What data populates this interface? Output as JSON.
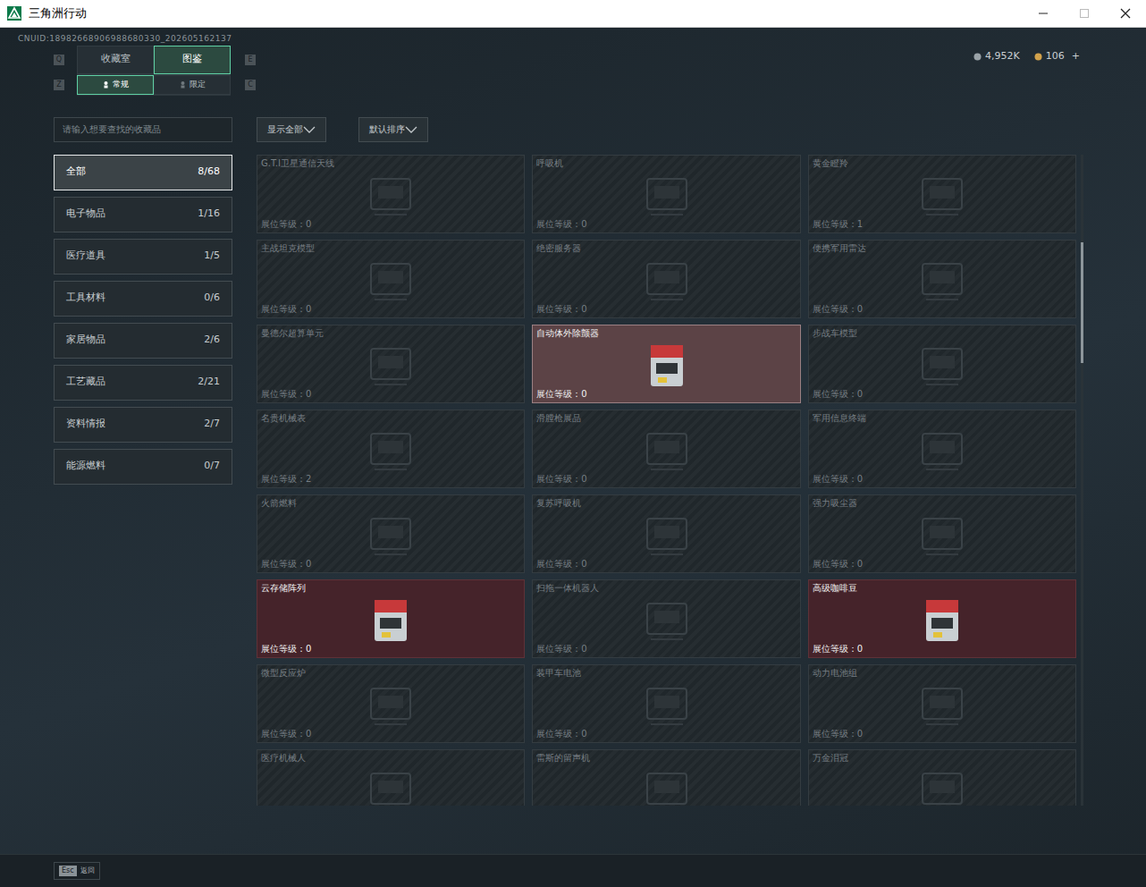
{
  "window": {
    "title": "三角洲行动"
  },
  "account": {
    "uid": "CNUID:18982668906988680330_202605162137"
  },
  "currency": [
    {
      "value": "4,952K",
      "add": ""
    },
    {
      "value": "106",
      "add": "+"
    }
  ],
  "main_tabs": {
    "prev_key": "Q",
    "next_key": "E",
    "items": [
      {
        "label": "收藏室",
        "selected": false
      },
      {
        "label": "图鉴",
        "selected": true
      }
    ]
  },
  "sub_tabs": {
    "prev_key": "Z",
    "next_key": "C",
    "items": [
      {
        "label": "常规",
        "selected": true
      },
      {
        "label": "限定",
        "selected": false
      }
    ]
  },
  "search": {
    "placeholder": "请输入想要查找的收藏品"
  },
  "filters": [
    {
      "label": "显示全部"
    },
    {
      "label": "默认排序"
    }
  ],
  "categories": [
    {
      "label": "全部",
      "count": "8/68",
      "selected": true
    },
    {
      "label": "电子物品",
      "count": "1/16",
      "selected": false
    },
    {
      "label": "医疗道具",
      "count": "1/5",
      "selected": false
    },
    {
      "label": "工具材料",
      "count": "0/6",
      "selected": false
    },
    {
      "label": "家居物品",
      "count": "2/6",
      "selected": false
    },
    {
      "label": "工艺藏品",
      "count": "2/21",
      "selected": false
    },
    {
      "label": "资料情报",
      "count": "2/7",
      "selected": false
    },
    {
      "label": "能源燃料",
      "count": "0/7",
      "selected": false
    }
  ],
  "items": [
    {
      "name": "G.T.I卫星通信天线",
      "level_text": "展位等级：0",
      "collected": false,
      "highlighted": false
    },
    {
      "name": "呼吸机",
      "level_text": "展位等级：0",
      "collected": false,
      "highlighted": false
    },
    {
      "name": "黄金瞪羚",
      "level_text": "展位等级：1",
      "collected": false,
      "highlighted": false
    },
    {
      "name": "主战坦克模型",
      "level_text": "展位等级：0",
      "collected": false,
      "highlighted": false
    },
    {
      "name": "绝密服务器",
      "level_text": "展位等级：0",
      "collected": false,
      "highlighted": false
    },
    {
      "name": "便携军用雷达",
      "level_text": "展位等级：0",
      "collected": false,
      "highlighted": false
    },
    {
      "name": "曼德尔超算单元",
      "level_text": "展位等级：0",
      "collected": false,
      "highlighted": false
    },
    {
      "name": "自动体外除颤器",
      "level_text": "展位等级：0",
      "collected": true,
      "highlighted": true
    },
    {
      "name": "步战车模型",
      "level_text": "展位等级：0",
      "collected": false,
      "highlighted": false
    },
    {
      "name": "名贵机械表",
      "level_text": "展位等级：2",
      "collected": false,
      "highlighted": false
    },
    {
      "name": "滑膛枪展品",
      "level_text": "展位等级：0",
      "collected": false,
      "highlighted": false
    },
    {
      "name": "军用信息终端",
      "level_text": "展位等级：0",
      "collected": false,
      "highlighted": false
    },
    {
      "name": "火箭燃料",
      "level_text": "展位等级：0",
      "collected": false,
      "highlighted": false
    },
    {
      "name": "复苏呼吸机",
      "level_text": "展位等级：0",
      "collected": false,
      "highlighted": false
    },
    {
      "name": "强力吸尘器",
      "level_text": "展位等级：0",
      "collected": false,
      "highlighted": false
    },
    {
      "name": "云存储阵列",
      "level_text": "展位等级：0",
      "collected": true,
      "highlighted": false
    },
    {
      "name": "扫拖一体机器人",
      "level_text": "展位等级：0",
      "collected": false,
      "highlighted": false
    },
    {
      "name": "高级咖啡豆",
      "level_text": "展位等级：0",
      "collected": true,
      "highlighted": false
    },
    {
      "name": "微型反应炉",
      "level_text": "展位等级：0",
      "collected": false,
      "highlighted": false
    },
    {
      "name": "装甲车电池",
      "level_text": "展位等级：0",
      "collected": false,
      "highlighted": false
    },
    {
      "name": "动力电池组",
      "level_text": "展位等级：0",
      "collected": false,
      "highlighted": false
    },
    {
      "name": "医疗机械人",
      "level_text": "",
      "collected": false,
      "highlighted": false
    },
    {
      "name": "雷斯的留声机",
      "level_text": "",
      "collected": false,
      "highlighted": false
    },
    {
      "name": "万金泪冠",
      "level_text": "",
      "collected": false,
      "highlighted": false
    }
  ],
  "footer": {
    "key": "Esc",
    "label": "返回"
  }
}
